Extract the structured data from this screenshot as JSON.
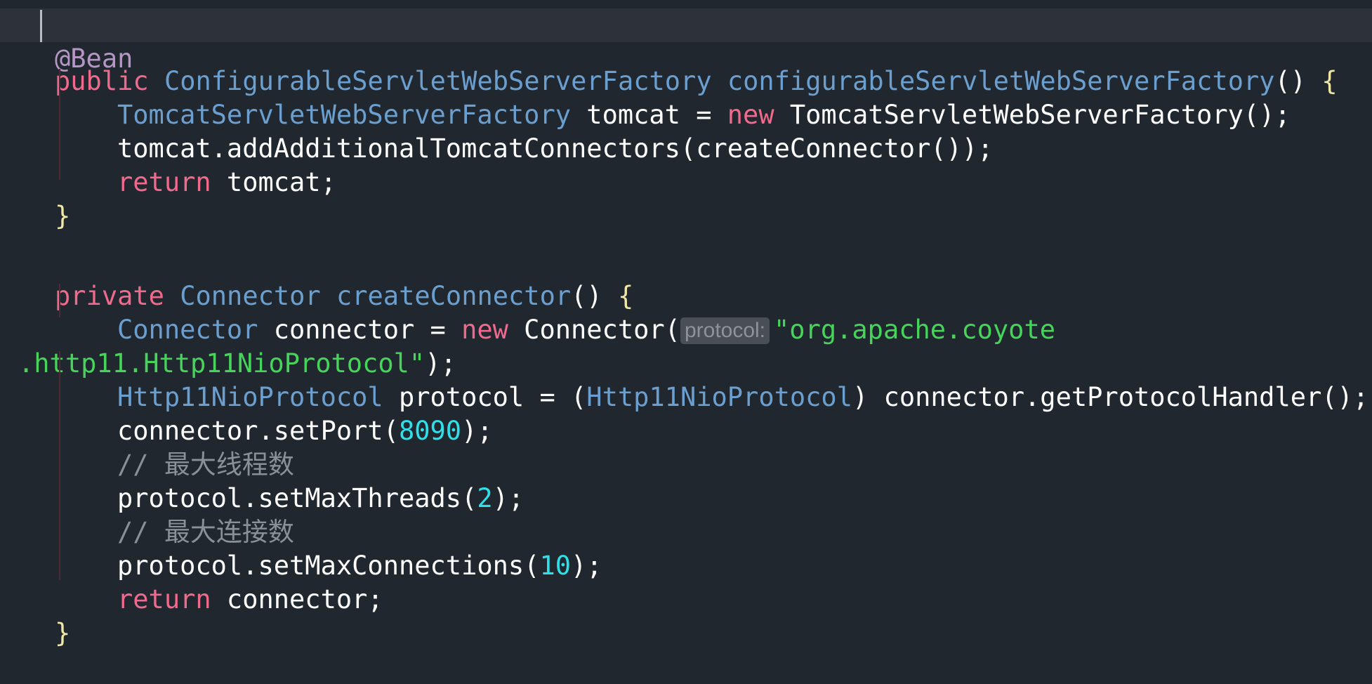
{
  "code": {
    "l1": {
      "ann": "@Bean"
    },
    "l2": {
      "kw": "public",
      "type": "ConfigurableServletWebServerFactory",
      "method": "configurableServletWebServerFactory",
      "tail": "() ",
      "brace": "{"
    },
    "l3": {
      "type": "TomcatServletWebServerFactory",
      "var": " tomcat = ",
      "kw": "new",
      "rest": " TomcatServletWebServerFactory();"
    },
    "l4": {
      "text": "tomcat.addAdditionalTomcatConnectors(createConnector());"
    },
    "l5": {
      "kw": "return",
      "rest": " tomcat;"
    },
    "l6": {
      "brace": "}"
    },
    "l8": {
      "kw": "private",
      "type": "Connector",
      "method": "createConnector",
      "tail": "() ",
      "brace": "{"
    },
    "l9": {
      "type": "Connector",
      "var": " connector = ",
      "kw": "new",
      "call": " Connector(",
      "hint": "protocol:",
      "str": "\"org.apache.coyote"
    },
    "l10": {
      "str": ".http11.Http11NioProtocol\"",
      "rest": ");"
    },
    "l11": {
      "type": "Http11NioProtocol",
      "var": " protocol = (",
      "cast": "Http11NioProtocol",
      "rest": ") connector.getProtocolHandler();"
    },
    "l12": {
      "pre": "connector.setPort(",
      "num": "8090",
      "post": ");"
    },
    "l13": {
      "comment": "// 最大线程数"
    },
    "l14": {
      "pre": "protocol.setMaxThreads(",
      "num": "2",
      "post": ");"
    },
    "l15": {
      "comment": "// 最大连接数"
    },
    "l16": {
      "pre": "protocol.setMaxConnections(",
      "num": "10",
      "post": ");"
    },
    "l17": {
      "kw": "return",
      "rest": " connector;"
    },
    "l18": {
      "brace": "}"
    }
  },
  "colors": {
    "background": "#21272e",
    "keyword": "#ef6a8d",
    "type": "#6b9fcf",
    "string": "#46d45a",
    "number": "#2fe0ea",
    "comment": "#8a8f98",
    "annotation": "#b596c4",
    "brace": "#f0e6a6"
  }
}
